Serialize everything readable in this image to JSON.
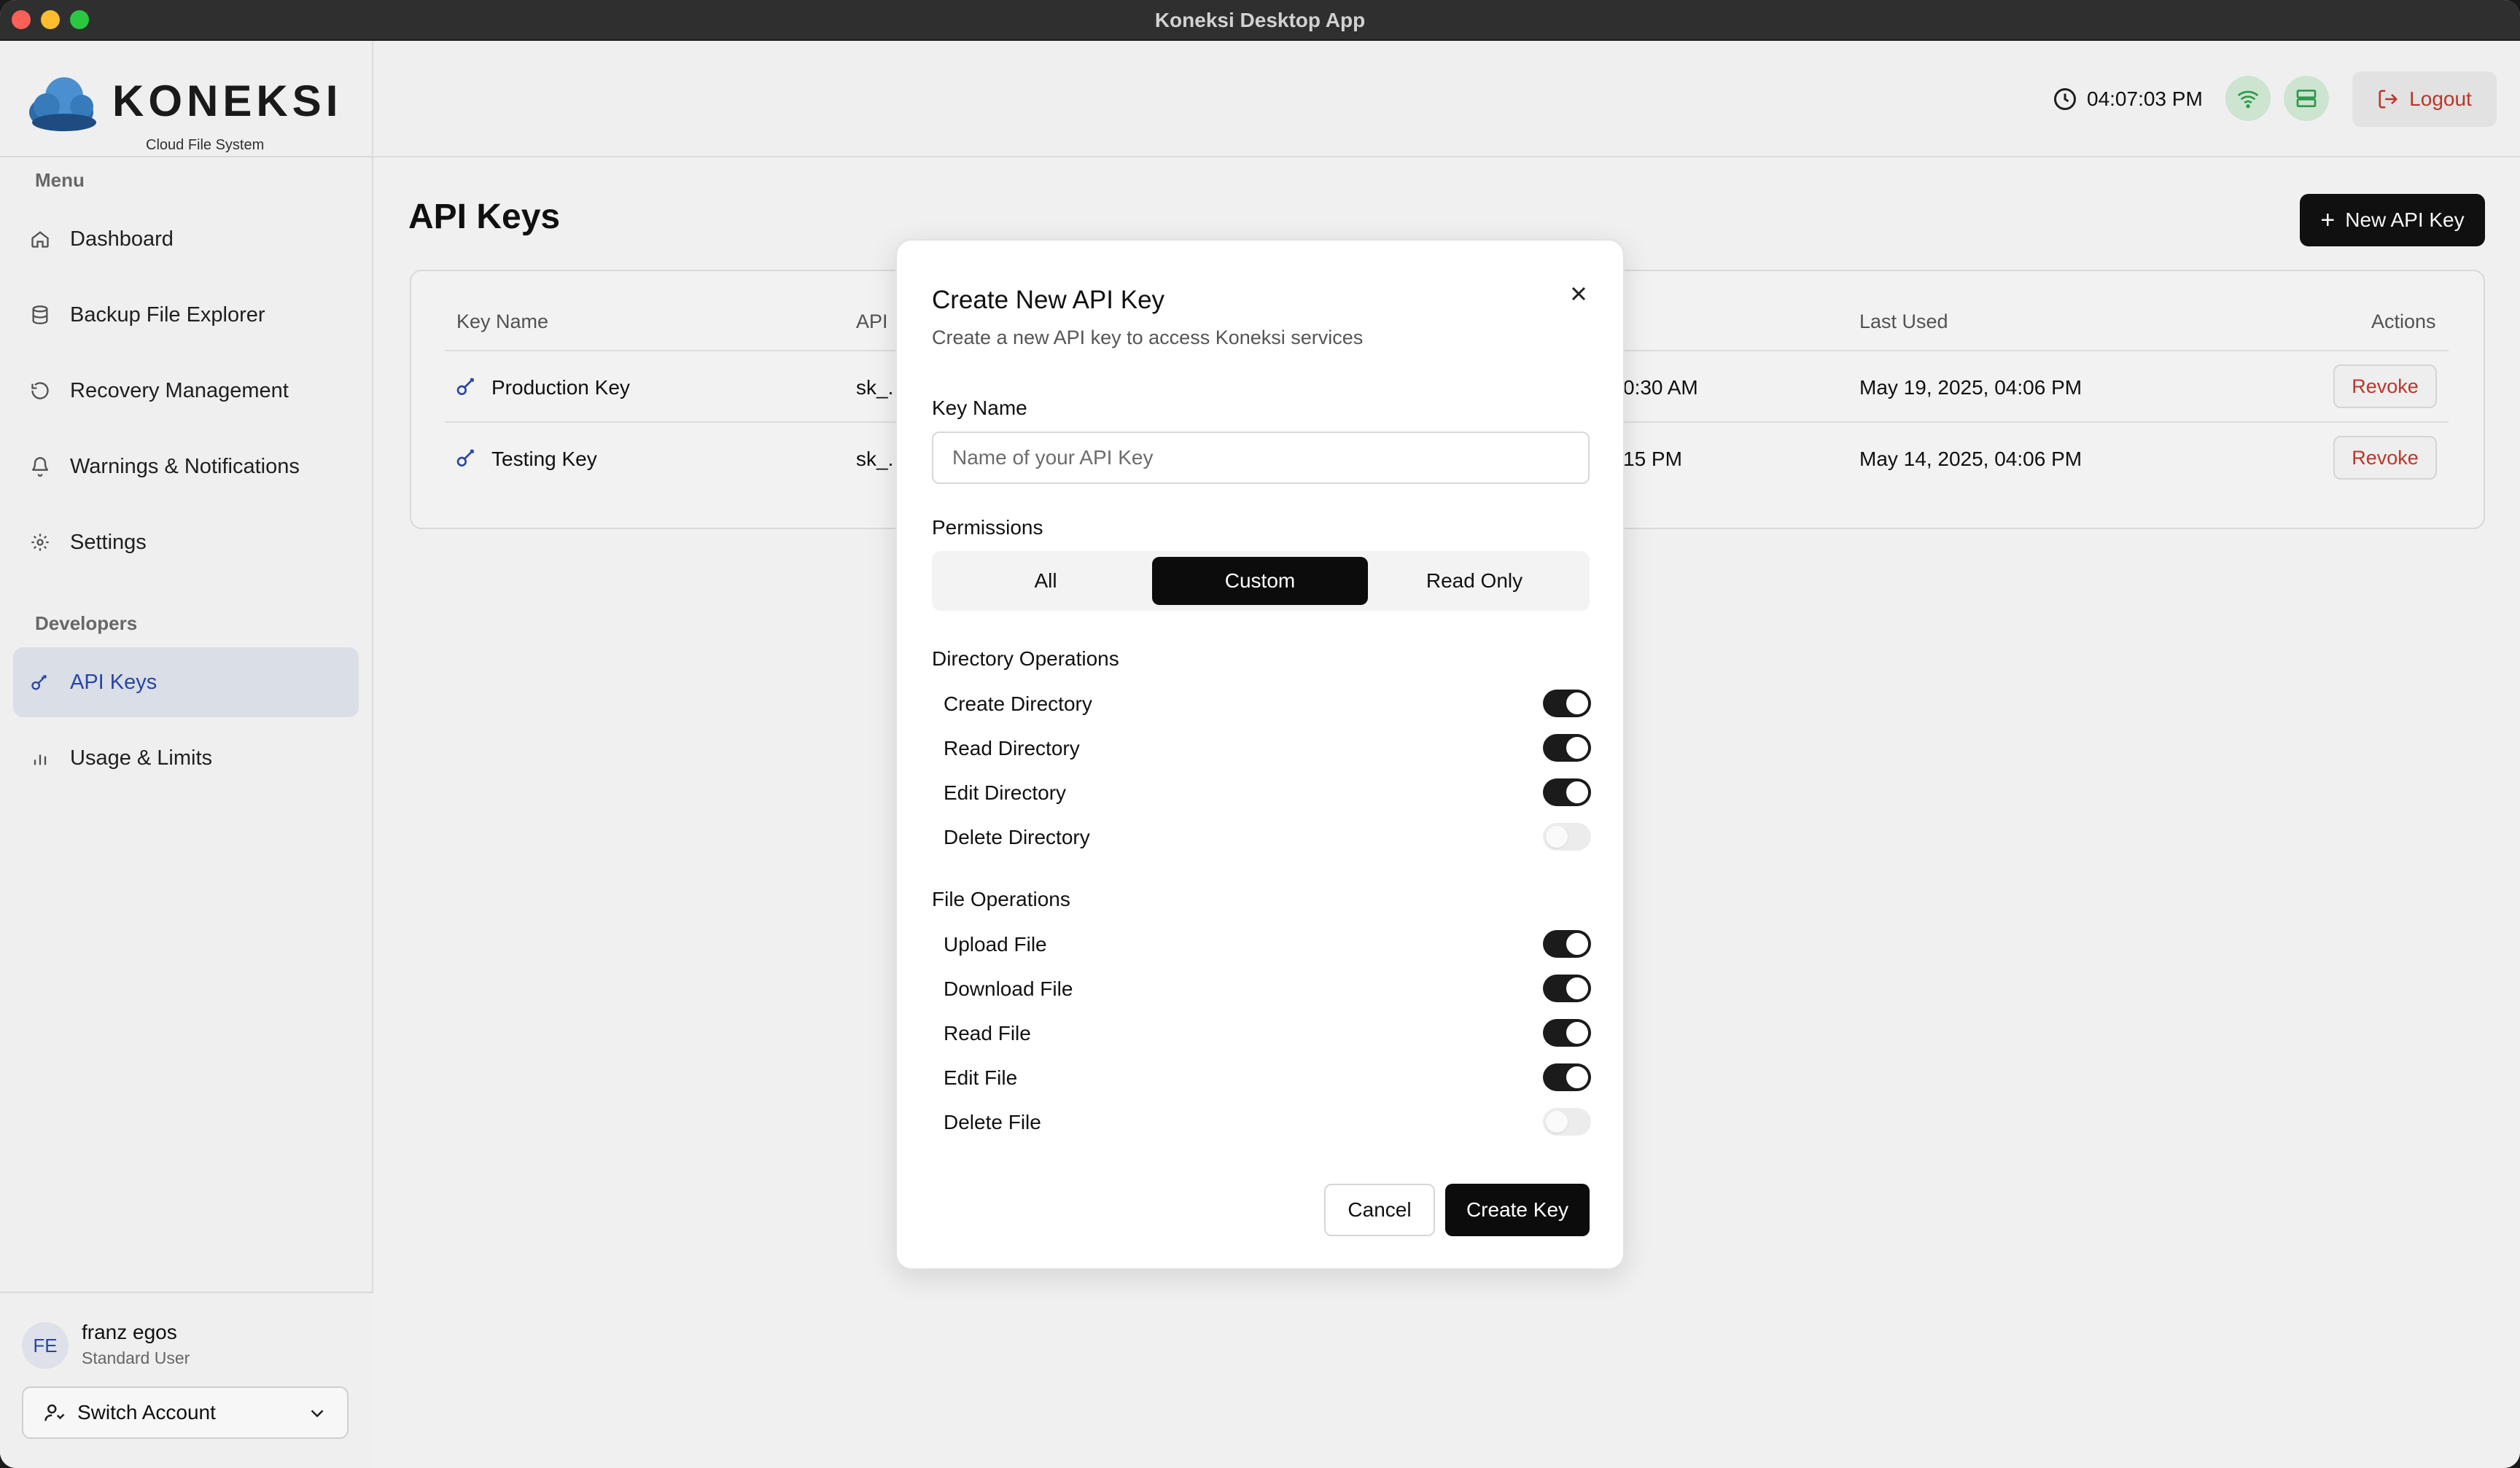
{
  "window": {
    "title": "Koneksi Desktop App"
  },
  "brand": {
    "name": "KONEKSI",
    "tagline": "Cloud File System"
  },
  "sidebar": {
    "menu_label": "Menu",
    "menu_items": [
      {
        "label": "Dashboard",
        "icon": "home-icon"
      },
      {
        "label": "Backup File Explorer",
        "icon": "database-icon"
      },
      {
        "label": "Recovery Management",
        "icon": "rotate-icon"
      },
      {
        "label": "Warnings & Notifications",
        "icon": "bell-icon"
      },
      {
        "label": "Settings",
        "icon": "gear-icon"
      }
    ],
    "developers_label": "Developers",
    "developer_items": [
      {
        "label": "API Keys",
        "icon": "key-icon",
        "active": true
      },
      {
        "label": "Usage & Limits",
        "icon": "bar-chart-icon"
      }
    ]
  },
  "user": {
    "initials": "FE",
    "name": "franz egos",
    "role": "Standard User",
    "switch_label": "Switch Account"
  },
  "header": {
    "time": "04:07:03 PM",
    "logout_label": "Logout"
  },
  "page": {
    "title": "API Keys",
    "new_key_label": "New API Key",
    "table": {
      "columns": [
        "Key Name",
        "API",
        "Last Used",
        "Actions"
      ],
      "rows": [
        {
          "name": "Production Key",
          "api": "sk_.",
          "created_partial": "0:30 AM",
          "last_used": "May 19, 2025, 04:06 PM",
          "action": "Revoke"
        },
        {
          "name": "Testing Key",
          "api": "sk_.",
          "created_partial": "15 PM",
          "last_used": "May 14, 2025, 04:06 PM",
          "action": "Revoke"
        }
      ]
    }
  },
  "modal": {
    "title": "Create New API Key",
    "description": "Create a new API key to access Koneksi services",
    "key_name_label": "Key Name",
    "key_name_placeholder": "Name of your API Key",
    "key_name_value": "",
    "permissions_label": "Permissions",
    "permission_modes": [
      "All",
      "Custom",
      "Read Only"
    ],
    "selected_mode": "Custom",
    "directory_label": "Directory Operations",
    "directory_ops": [
      {
        "label": "Create Directory",
        "enabled": true
      },
      {
        "label": "Read Directory",
        "enabled": true
      },
      {
        "label": "Edit Directory",
        "enabled": true
      },
      {
        "label": "Delete Directory",
        "enabled": false
      }
    ],
    "file_label": "File Operations",
    "file_ops": [
      {
        "label": "Upload File",
        "enabled": true
      },
      {
        "label": "Download File",
        "enabled": true
      },
      {
        "label": "Read File",
        "enabled": true
      },
      {
        "label": "Edit File",
        "enabled": true
      },
      {
        "label": "Delete File",
        "enabled": false
      }
    ],
    "cancel_label": "Cancel",
    "create_label": "Create Key"
  },
  "colors": {
    "accent": "#2a49a8",
    "danger": "#c0392b",
    "primary_button": "#0c0c0c",
    "status_ok": "#d3ecd7"
  }
}
